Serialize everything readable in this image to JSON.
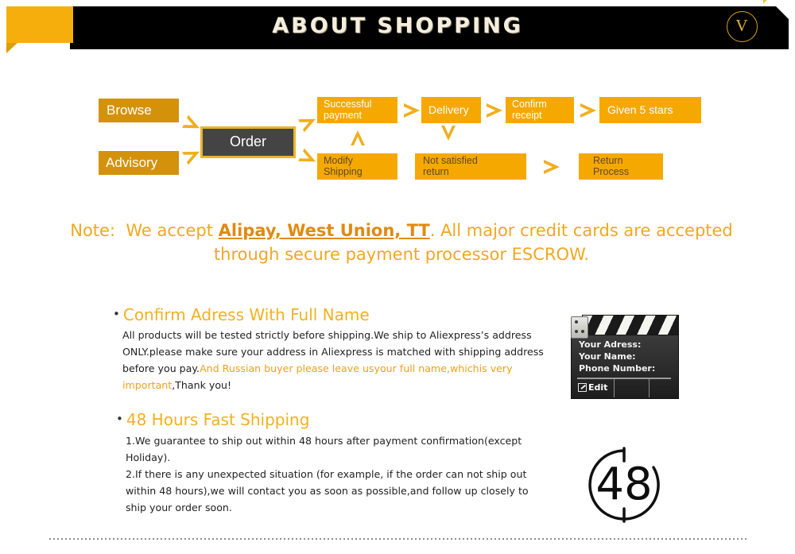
{
  "header": {
    "title": "ABOUT SHOPPING",
    "logo_letter": "V",
    "logo_icon": "circle-v-logo-icon",
    "tab_icon": "yellow-speech-tab-icon",
    "stripes_icon": "diagonal-stripes-icon"
  },
  "flowchart": {
    "nodes": {
      "browse": "Browse",
      "advisory": "Advisory",
      "order": "Order",
      "successful_payment": "Successful\npayment",
      "modify_shipping": "Modify\nShipping",
      "delivery": "Delivery",
      "not_satisfied_return": "Not satisfied\nreturn",
      "confirm_receipt": "Confirm\nreceipt",
      "return_process": "Return\nProcess",
      "given_5_stars": "Given 5 stars"
    },
    "arrow_icons": [
      "arrow-right-icon",
      "arrow-down-icon",
      "arrow-up-icon",
      "arrow-left-icon"
    ],
    "colors": {
      "dark_orange": "#D4920B",
      "bright_orange": "#F5A800",
      "order_fill": "#444444",
      "order_border": "#E9B52C",
      "arrow": "#F0AE1E"
    }
  },
  "note": {
    "label": "Note:",
    "before": "We accept",
    "payments": "Alipay, West Union, TT",
    "after": ". All major credit cards are accepted through secure payment processor ESCROW.",
    "color": "#F0A81E"
  },
  "sections": [
    {
      "bullet": "•",
      "heading": "Confirm Adress With Full Name",
      "body_plain_1": "All products will be tested strictly before shipping.We ship to Aliexpress’s address ONLY.please make sure your address in Aliexpress is matched with shipping address before you pay.",
      "body_highlight": "And Russian buyer please leave usyour full name,whichis very important",
      "body_plain_2": ",Thank you!",
      "heading_color": "#F3B01F"
    },
    {
      "bullet": "•",
      "heading": "48 Hours Fast Shipping",
      "body_line_1": "1.We guarantee to ship out within 48 hours after payment confirmation(except Holiday).",
      "body_line_2": "2.If there is any unexpected situation (for example, if the order can not ship out within 48 hours),we will contact you as soon as possible,and follow up closely to ship your order soon.",
      "heading_color": "#F3B01F"
    }
  ],
  "clapperboard": {
    "icon": "clapperboard-icon",
    "line1": "Your Adress:",
    "line2": "Your Name:",
    "line3": "Phone Number:",
    "edit_label": "Edit",
    "edit_icon": "edit-pencil-icon"
  },
  "clock": {
    "icon": "48-hours-clock-icon",
    "value": "48"
  },
  "footer": {
    "divider_icon": "dotted-divider-icon"
  }
}
